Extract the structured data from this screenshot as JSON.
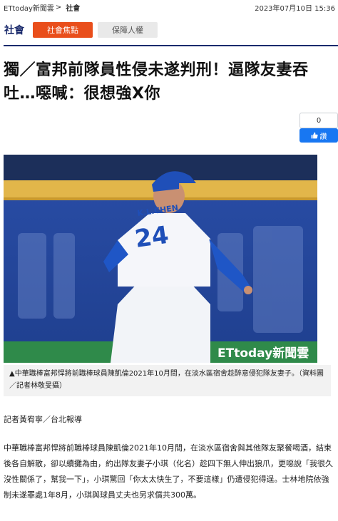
{
  "breadcrumb": {
    "home": "ETtoday新聞雲",
    "separator": ">",
    "current": "社會"
  },
  "datetime": "2023年07月10日 15:36",
  "section": {
    "title": "社會",
    "tags": [
      "社會焦點",
      "保障人權"
    ]
  },
  "headline": "獨／富邦前隊員性侵未遂判刑！逼隊友妻吞吐…噁喊：很想強X你",
  "social": {
    "like_count": "0",
    "like_label": "讚"
  },
  "photo": {
    "watermark": "ETtoday新聞雲",
    "jersey_name": "K.L.CHEN",
    "jersey_number": "24"
  },
  "caption": "▲中華職棒富邦悍將前職棒球員陳凱倫2021年10月間，在淡水區宿舍趁醉意侵犯隊友妻子。（資料圖／記者林敬旻攝）",
  "reporter": "記者黃宥寧／台北報導",
  "body": "中華職棒富邦悍將前職棒球員陳凱倫2021年10月間，在淡水區宿舍與其他隊友聚餐喝酒，結束後各自解散，卻以續攤為由，約出隊友妻子小琪（化名）趁四下無人伸出狼爪，更噁說「我很久沒性關係了，幫我一下」，小琪驚回「你太太快生了，不要這樣」仍遭侵犯得逞。士林地院依強制未遂罪處1年8月，小琪與球員丈夫也另求償共300萬。",
  "colors": {
    "brand_navy": "#1a2a6c",
    "tag_orange": "#e94e1b",
    "like_blue": "#1877f2"
  }
}
